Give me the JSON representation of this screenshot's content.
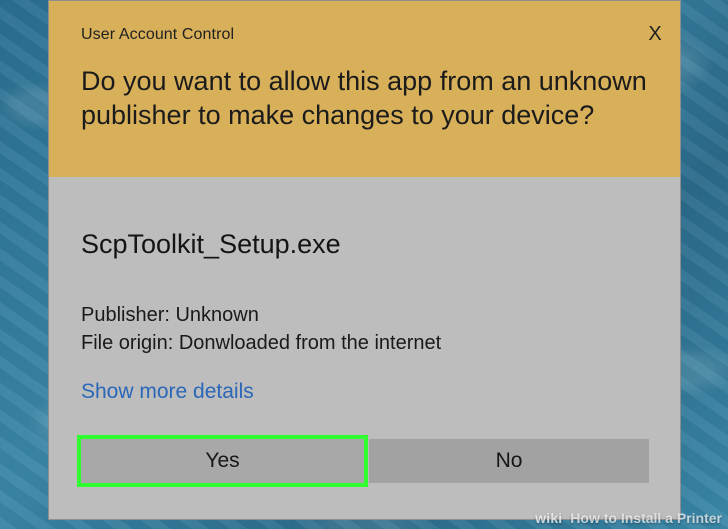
{
  "dialog": {
    "title": "User Account Control",
    "close_label": "X",
    "question": "Do you want to allow this app from an unknown publisher to make changes to your device?",
    "app_name": "ScpToolkit_Setup.exe",
    "publisher_line": "Publisher: Unknown",
    "origin_line": "File origin: Donwloaded from the internet",
    "show_more_details": "Show more details",
    "buttons": {
      "yes": "Yes",
      "no": "No"
    }
  },
  "watermark": {
    "brand": "wiki",
    "text": "How to Install a Printer"
  },
  "colors": {
    "header": "#d8b05a",
    "body": "#bdbdbd",
    "link": "#2a67b8",
    "highlight": "#2fff2f",
    "background": "#2f6f8f"
  },
  "icons": {
    "close": "close-icon"
  }
}
